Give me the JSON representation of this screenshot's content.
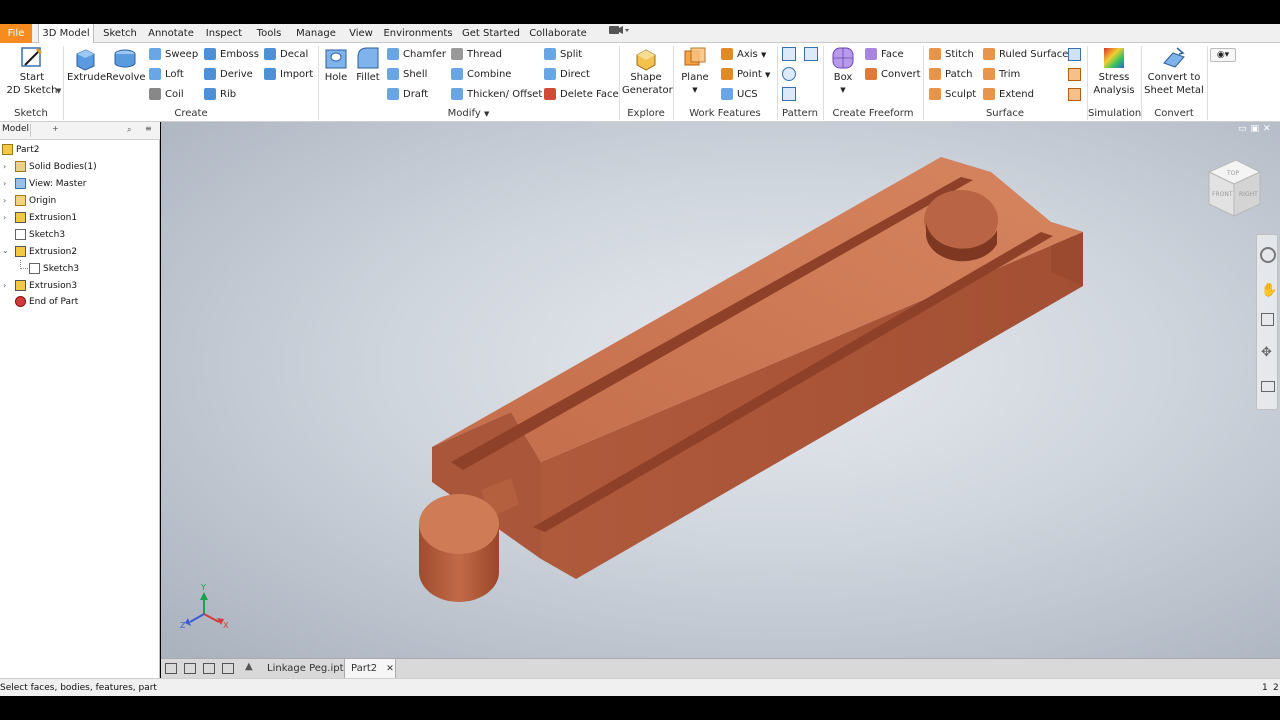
{
  "menu": {
    "tabs": [
      "File",
      "3D Model",
      "Sketch",
      "Annotate",
      "Inspect",
      "Tools",
      "Manage",
      "View",
      "Environments",
      "Get Started",
      "Collaborate"
    ]
  },
  "ribbon": {
    "sketch": {
      "start_line1": "Start",
      "start_line2": "2D Sketch",
      "title": "Sketch"
    },
    "create": {
      "extrude": "Extrude",
      "revolve": "Revolve",
      "sweep": "Sweep",
      "loft": "Loft",
      "coil": "Coil",
      "emboss": "Emboss",
      "derive": "Derive",
      "rib": "Rib",
      "decal": "Decal",
      "import": "Import",
      "title": "Create"
    },
    "modify": {
      "hole": "Hole",
      "fillet": "Fillet",
      "chamfer": "Chamfer",
      "shell": "Shell",
      "draft": "Draft",
      "thread": "Thread",
      "combine": "Combine",
      "thicken": "Thicken/ Offset",
      "split": "Split",
      "direct": "Direct",
      "delete_face": "Delete Face",
      "title": "Modify"
    },
    "explore": {
      "shape_line1": "Shape",
      "shape_line2": "Generator",
      "title": "Explore"
    },
    "work": {
      "plane": "Plane",
      "axis": "Axis",
      "point": "Point",
      "ucs": "UCS",
      "title": "Work Features"
    },
    "pattern": {
      "title": "Pattern"
    },
    "freeform": {
      "box": "Box",
      "face": "Face",
      "convert": "Convert",
      "title": "Create Freeform"
    },
    "surface": {
      "stitch": "Stitch",
      "patch": "Patch",
      "sculpt": "Sculpt",
      "ruled": "Ruled Surface",
      "trim": "Trim",
      "extend": "Extend",
      "title": "Surface"
    },
    "simulation": {
      "stress_line1": "Stress",
      "stress_line2": "Analysis",
      "title": "Simulation"
    },
    "convert": {
      "sheet_line1": "Convert to",
      "sheet_line2": "Sheet Metal",
      "title": "Convert"
    }
  },
  "browser": {
    "title": "Model",
    "items": [
      "Part2",
      "Solid Bodies(1)",
      "View: Master",
      "Origin",
      "Extrusion1",
      "Sketch3",
      "Extrusion2",
      "Sketch3",
      "Extrusion3",
      "End of Part"
    ]
  },
  "viewcube": {
    "top": "TOP",
    "front": "FRONT",
    "right": "RIGHT"
  },
  "triad": {
    "x": "X",
    "y": "Y",
    "z": "Z"
  },
  "doctabs": {
    "tab1": "Linkage Peg.ipt",
    "tab2": "Part2",
    "close": "✕"
  },
  "status": {
    "message": "Select faces, bodies, features, part",
    "right1": "1",
    "right2": "2"
  },
  "colors": {
    "file_tab": "#f68b1f",
    "model_body": "#c8714f",
    "viewport": "#cfd5dd"
  }
}
